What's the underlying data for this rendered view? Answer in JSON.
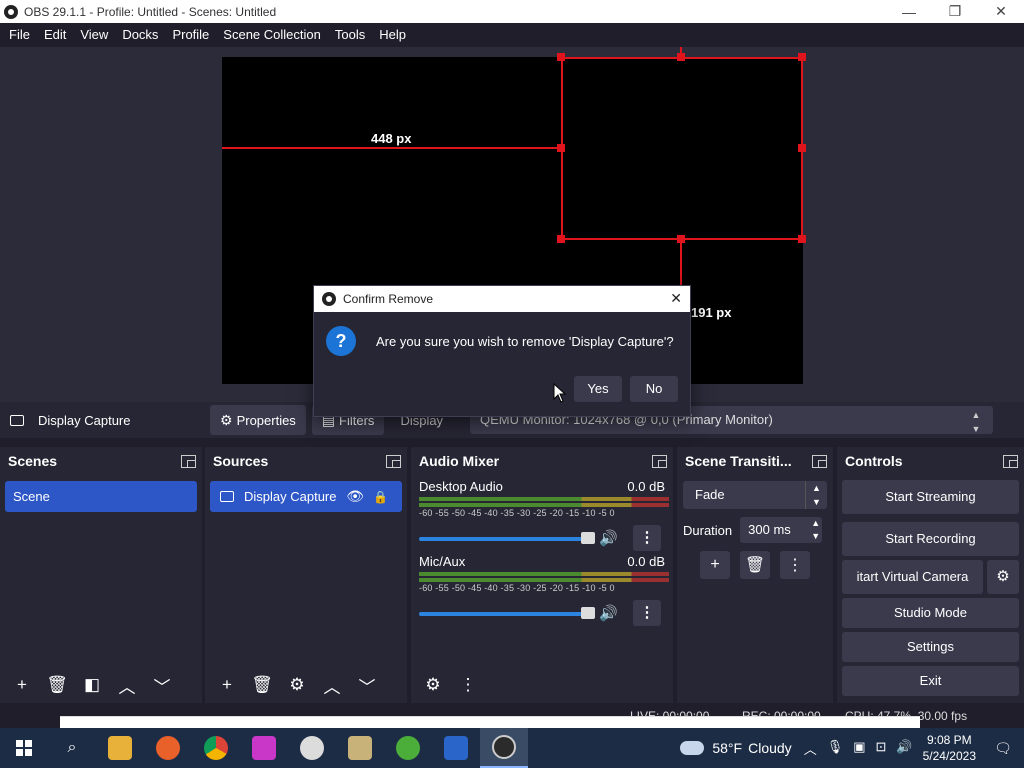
{
  "window": {
    "title": "OBS 29.1.1 - Profile: Untitled - Scenes: Untitled",
    "minimize": "—",
    "maximize": "❐",
    "close": "✕"
  },
  "menu": [
    "File",
    "Edit",
    "View",
    "Docks",
    "Profile",
    "Scene Collection",
    "Tools",
    "Help"
  ],
  "preview": {
    "left_measure": "448 px",
    "bottom_measure": "191 px"
  },
  "source_toolbar": {
    "source_name": "Display Capture",
    "properties_label": "Properties",
    "filters_label": "Filters",
    "display_label": "Display",
    "display_value": "QEMU Monitor: 1024x768 @ 0,0 (Primary Monitor)"
  },
  "docks": {
    "scenes": {
      "title": "Scenes",
      "items": [
        "Scene"
      ]
    },
    "sources": {
      "title": "Sources",
      "items": [
        "Display Capture"
      ]
    },
    "audio_mixer": {
      "title": "Audio Mixer",
      "scale": "-60 -55 -50 -45 -40 -35 -30 -25 -20 -15 -10 -5 0",
      "channels": [
        {
          "name": "Desktop Audio",
          "level": "0.0 dB"
        },
        {
          "name": "Mic/Aux",
          "level": "0.0 dB"
        }
      ]
    },
    "transitions": {
      "title": "Scene Transiti...",
      "selected": "Fade",
      "duration_label": "Duration",
      "duration_value": "300 ms"
    },
    "controls": {
      "title": "Controls",
      "start_streaming": "Start Streaming",
      "start_recording": "Start Recording",
      "start_virtual_camera": "itart Virtual Camera",
      "studio_mode": "Studio Mode",
      "settings": "Settings",
      "exit": "Exit"
    }
  },
  "statusbar": {
    "live": "LIVE: 00:00:00",
    "rec": "REC: 00:00:00",
    "cpu": "CPU: 47.7%, 30.00 fps"
  },
  "dialog": {
    "title": "Confirm Remove",
    "message": "Are you sure you wish to remove 'Display Capture'?",
    "yes": "Yes",
    "no": "No"
  },
  "taskbar": {
    "weather_temp": "58°F",
    "weather_text": "Cloudy",
    "time": "9:08 PM",
    "date": "5/24/2023"
  },
  "colors": {
    "accent": "#2d57c7",
    "selection_red": "#e0141d",
    "panel": "#272634",
    "background": "#1f1e2a"
  }
}
